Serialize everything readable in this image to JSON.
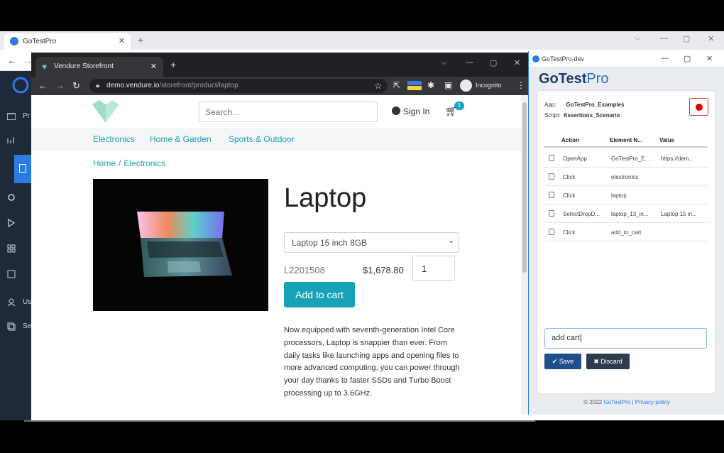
{
  "outer": {
    "tab_title": "GoTestPro",
    "win_controls": [
      "⌵",
      "—",
      "▢",
      "✕"
    ],
    "sidebar_labels": [
      "Pr",
      "Us",
      "Se"
    ]
  },
  "inner": {
    "tab_title": "Vendure Storefront",
    "url_host": "demo.vendure.io",
    "url_path": "/storefront/product/laptop",
    "incognito_label": "Incognito"
  },
  "store": {
    "search_placeholder": "Search...",
    "signin_label": "Sign In",
    "cart_count": "1",
    "categories": [
      "Electronics",
      "Home & Garden",
      "Sports & Outdoor"
    ],
    "breadcrumb": [
      "Home",
      "Electronics"
    ],
    "product_title": "Laptop",
    "variant_selected": "Laptop 15 inch 8GB",
    "sku": "L2201508",
    "price": "$1,678.80",
    "quantity": "1",
    "add_to_cart_label": "Add to cart",
    "description": "Now equipped with seventh-generation Intel Core processors, Laptop is snappier than ever. From daily tasks like launching apps and opening files to more advanced computing, you can power through your day thanks to faster SSDs and Turbo Boost processing up to 3.6GHz."
  },
  "gotestpro": {
    "window_title": "GoTestPro-dev",
    "brand_go": "GoTest",
    "brand_pro": "Pro",
    "app_label": "App:",
    "app_value": "GoTestPro_Examples",
    "script_label": "Script:",
    "script_value": "Assertions_Scenario",
    "columns": [
      "Action",
      "Element N...",
      "Value"
    ],
    "steps": [
      {
        "action": "OpenApp",
        "element": "GoTestPro_E...",
        "value": "https://dem..."
      },
      {
        "action": "Click",
        "element": "electronics",
        "value": ""
      },
      {
        "action": "Click",
        "element": "laptop",
        "value": ""
      },
      {
        "action": "SelectDropD...",
        "element": "laptop_13_in...",
        "value": "Laptop 15 in..."
      },
      {
        "action": "Click",
        "element": "add_to_cart",
        "value": ""
      }
    ],
    "input_value": "add cart",
    "save_label": "Save",
    "discard_label": "Discard",
    "footer_copy": "© 2022",
    "footer_brand": "GoTestPro",
    "footer_sep": "|",
    "footer_privacy": "Privacy policy",
    "record_color": "#e00000"
  }
}
